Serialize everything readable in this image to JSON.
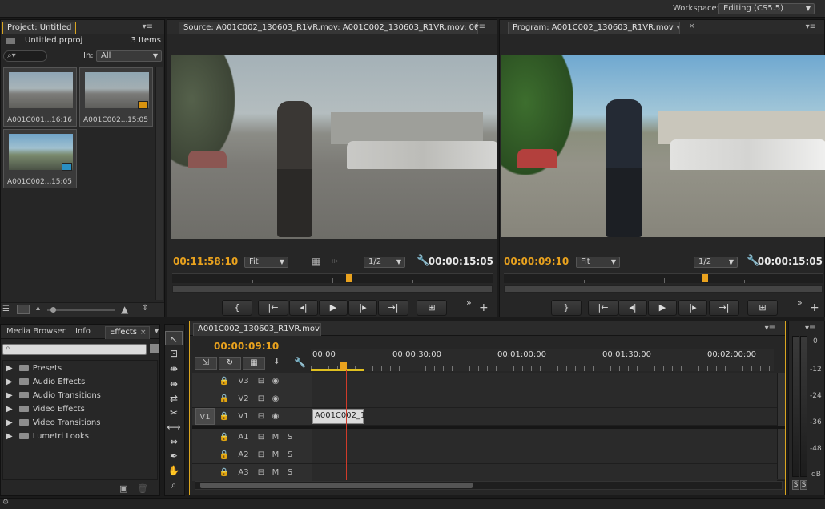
{
  "workspace": {
    "label": "Workspace:",
    "value": "Editing (CS5.5)"
  },
  "project": {
    "tab": "Project: Untitled",
    "file": "Untitled.prproj",
    "count": "3 Items",
    "in_label": "In:",
    "in_value": "All",
    "items": [
      {
        "name": "A001C001...",
        "duration": "16:16"
      },
      {
        "name": "A001C002...",
        "duration": "15:05"
      },
      {
        "name": "A001C002...",
        "duration": "15:05"
      }
    ]
  },
  "source": {
    "tab": "Source: A001C002_130603_R1VR.mov: A001C002_130603_R1VR.mov: 00:0(",
    "timecode": "00:11:58:10",
    "fit": "Fit",
    "resolution": "1/2",
    "duration": "00:00:15:05"
  },
  "program": {
    "tab": "Program: A001C002_130603_R1VR.mov",
    "timecode": "00:00:09:10",
    "fit": "Fit",
    "resolution": "1/2",
    "duration": "00:00:15:05"
  },
  "effects": {
    "tabs": [
      "Media Browser",
      "Info",
      "Effects"
    ],
    "items": [
      "Presets",
      "Audio Effects",
      "Audio Transitions",
      "Video Effects",
      "Video Transitions",
      "Lumetri Looks"
    ]
  },
  "timeline": {
    "tab": "A001C002_130603_R1VR.mov",
    "timecode": "00:00:09:10",
    "ruler": [
      "00:00",
      "00:00:30:00",
      "00:01:00:00",
      "00:01:30:00",
      "00:02:00:00"
    ],
    "video_tracks": [
      "V3",
      "V2",
      "V1"
    ],
    "audio_tracks": [
      "A1",
      "A2",
      "A3"
    ],
    "source_patch": "V1",
    "clip_label": "A001C002_1",
    "mute": "M",
    "solo": "S"
  },
  "meter": {
    "scale": [
      "0",
      "-12",
      "-24",
      "-36",
      "-48",
      "dB"
    ],
    "solo": [
      "S",
      "S"
    ]
  }
}
